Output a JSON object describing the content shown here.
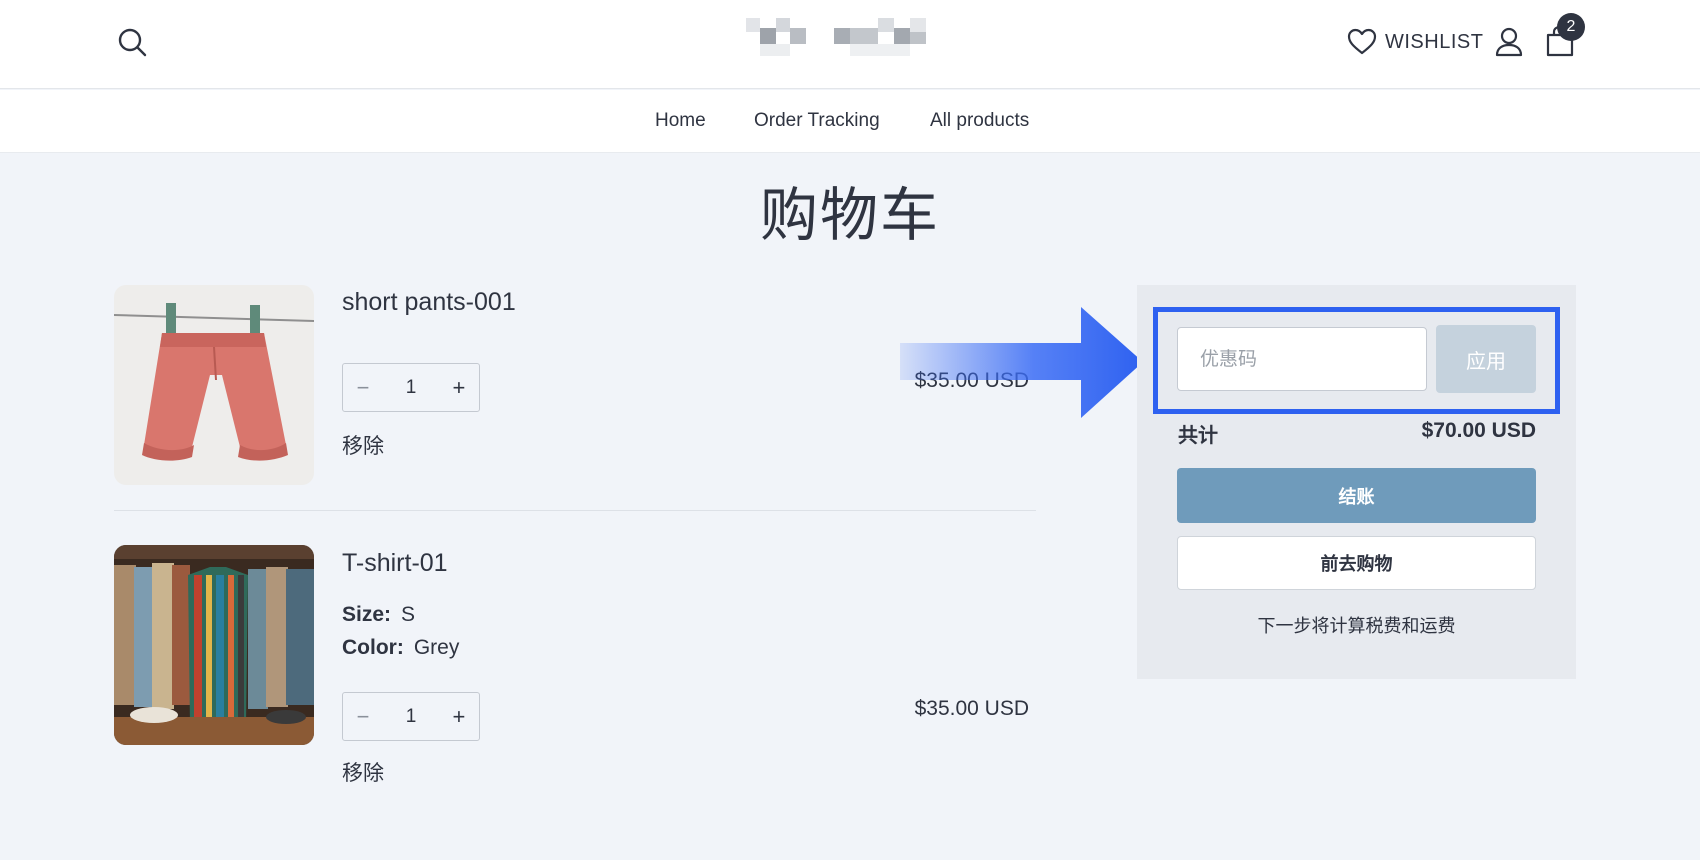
{
  "header": {
    "wishlist_label": "WISHLIST",
    "cart_count": "2"
  },
  "nav": {
    "items": [
      {
        "label": "Home"
      },
      {
        "label": "Order Tracking"
      },
      {
        "label": "All products"
      }
    ]
  },
  "page": {
    "title": "购物车"
  },
  "cart": {
    "items": [
      {
        "name": "short pants-001",
        "quantity": "1",
        "remove_label": "移除",
        "price": "$35.00 USD",
        "image": "red-shorts-photo"
      },
      {
        "name": "T-shirt-01",
        "size_label": "Size:",
        "size_value": "S",
        "color_label": "Color:",
        "color_value": "Grey",
        "quantity": "1",
        "remove_label": "移除",
        "price": "$35.00 USD",
        "image": "shirts-rack-photo"
      }
    ],
    "stepper": {
      "minus": "−",
      "plus": "+"
    }
  },
  "summary": {
    "coupon_placeholder": "优惠码",
    "apply_label": "应用",
    "total_label": "共计",
    "total_value": "$70.00 USD",
    "checkout_label": "结账",
    "continue_label": "前去购物",
    "tax_note": "下一步将计算税费和运费"
  },
  "colors": {
    "page_bg": "#f1f4f9",
    "text": "#2f3441",
    "highlight_border": "#2e61f0",
    "checkout_bg": "#6f9bbb",
    "apply_bg": "#c5d2dd",
    "arrow": "#3a6cf5"
  },
  "icons": [
    "search-icon",
    "heart-icon",
    "user-icon",
    "bag-icon",
    "arrow-right-icon"
  ]
}
